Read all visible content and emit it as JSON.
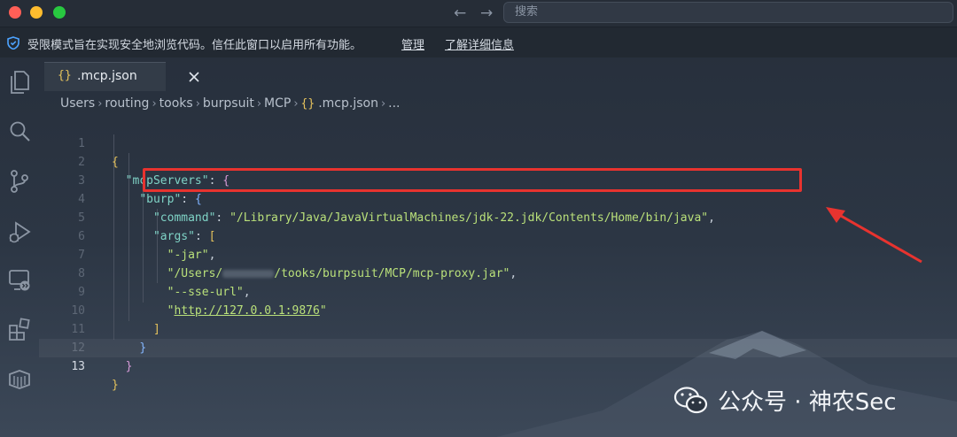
{
  "titlebar": {
    "search_placeholder": "搜索"
  },
  "banner": {
    "message": "受限模式旨在实现安全地浏览代码。信任此窗口以启用所有功能。",
    "manage_link": "管理",
    "learn_more_link": "了解详细信息"
  },
  "tab": {
    "filename": ".mcp.json"
  },
  "breadcrumb": {
    "segments": [
      "Users",
      "routing",
      "tooks",
      "burpsuit",
      "MCP",
      ".mcp.json",
      "..."
    ]
  },
  "editor": {
    "line_numbers": [
      "1",
      "2",
      "3",
      "4",
      "5",
      "6",
      "7",
      "8",
      "9",
      "10",
      "11",
      "12",
      "13"
    ],
    "current_line": "13",
    "tokens": {
      "l1_brace": "{",
      "l2_key": "\"mcpServers\"",
      "l2_sep": ": ",
      "l2_brace": "{",
      "l3_key": "\"burp\"",
      "l3_sep": ": ",
      "l3_brace": "{",
      "l4_key": "\"command\"",
      "l4_sep": ": ",
      "l4_value": "\"/Library/Java/JavaVirtualMachines/jdk-22.jdk/Contents/Home/bin/java\"",
      "l4_comma": ",",
      "l5_key": "\"args\"",
      "l5_sep": ": ",
      "l5_bracket": "[",
      "l6_value": "\"-jar\"",
      "l6_comma": ",",
      "l7_prefix": "\"/Users/",
      "l7_suffix": "/tooks/burpsuit/MCP/mcp-proxy.jar\"",
      "l7_comma": ",",
      "l8_value": "\"--sse-url\"",
      "l8_comma": ",",
      "l9_quote_open": "\"",
      "l9_url": "http://127.0.0.1:9876",
      "l9_quote_close": "\"",
      "l10_bracket": "]",
      "l11_brace": "}",
      "l12_brace": "}",
      "l13_brace": "}"
    }
  },
  "watermark": {
    "text": "公众号 · 神农Sec"
  },
  "colors": {
    "highlight_box": "#e8332f",
    "json_key": "#7fd3c6",
    "json_string": "#b9e07a",
    "brace": "#e6c35c"
  },
  "icons": [
    "shield-icon",
    "explorer-icon",
    "search-icon",
    "source-control-icon",
    "run-debug-icon",
    "remote-explorer-icon",
    "extensions-icon",
    "containers-icon",
    "close-icon",
    "wechat-icon",
    "red-arrow-annotation"
  ]
}
